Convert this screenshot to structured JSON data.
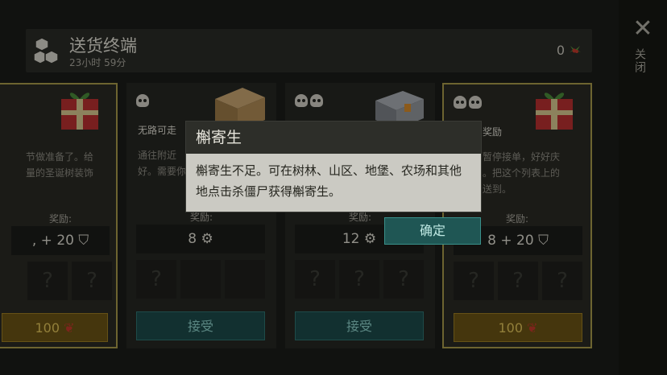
{
  "header": {
    "title": "送货终端",
    "timer": "23小时 59分",
    "count": "0"
  },
  "rail": {
    "close_label": "关闭"
  },
  "cards": [
    {
      "skulls": 0,
      "title": "",
      "desc_lines": [
        "节做准备了。给",
        "量的圣诞树装饰"
      ],
      "reward_label": "奖励:",
      "reward": ", + 20",
      "button": "100",
      "button_type": "price",
      "highlight": true
    },
    {
      "skulls": 1,
      "title": "无路可走",
      "desc_lines": [
        "通往附近",
        "好。需要你"
      ],
      "reward_label": "奖励:",
      "reward": "8",
      "button": "接受",
      "button_type": "accept",
      "highlight": false
    },
    {
      "skulls": 2,
      "title": "",
      "desc_lines": [
        "",
        ""
      ],
      "reward_label": "奖励:",
      "reward": "12",
      "button": "接受",
      "button_type": "accept",
      "highlight": false
    },
    {
      "skulls": 2,
      "title": "奖励",
      "desc_lines": [
        "暂停接单，好好庆",
        "。把这个列表上的",
        "送到。"
      ],
      "reward_label": "奖励:",
      "reward": "8  + 20",
      "button": "100",
      "button_type": "price",
      "highlight": true
    }
  ],
  "dialog": {
    "title": "槲寄生",
    "body": "槲寄生不足。可在树林、山区、地堡、农场和其他地点击杀僵尸获得槲寄生。",
    "ok": "确定"
  },
  "colors": {
    "accent_teal": "#1f5654",
    "price_gold": "#6a5314",
    "highlight_border": "#a89a4a"
  }
}
